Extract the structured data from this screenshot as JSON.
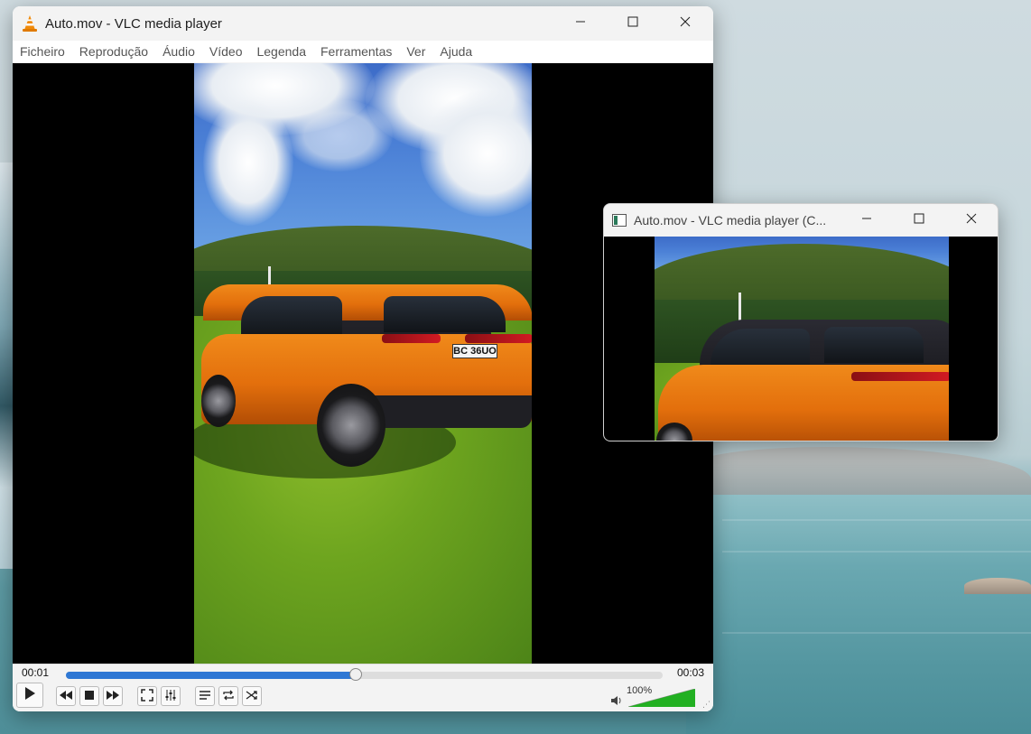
{
  "main_window": {
    "title": "Auto.mov - VLC media player",
    "menu": [
      "Ficheiro",
      "Reprodução",
      "Áudio",
      "Vídeo",
      "Legenda",
      "Ferramentas",
      "Ver",
      "Ajuda"
    ],
    "video": {
      "plate_text": "BC 36UO"
    },
    "controls": {
      "elapsed": "00:01",
      "total": "00:03",
      "progress_fraction": 0.485,
      "volume_label": "100%",
      "volume_fraction": 1.0
    }
  },
  "second_window": {
    "title": "Auto.mov - VLC media player (C..."
  },
  "icons": {
    "app": "vlc-cone-icon",
    "minimize": "minimize-icon",
    "maximize": "maximize-icon",
    "close": "close-icon",
    "play": "play-icon",
    "prev": "previous-icon",
    "stop": "stop-icon",
    "next": "next-icon",
    "fullscreen": "fullscreen-icon",
    "extended": "extended-settings-icon",
    "playlist": "playlist-icon",
    "loop": "loop-icon",
    "shuffle": "shuffle-icon",
    "volume": "speaker-icon"
  },
  "colors": {
    "accent": "#2f78d4",
    "volume_bar": "#22b022"
  }
}
